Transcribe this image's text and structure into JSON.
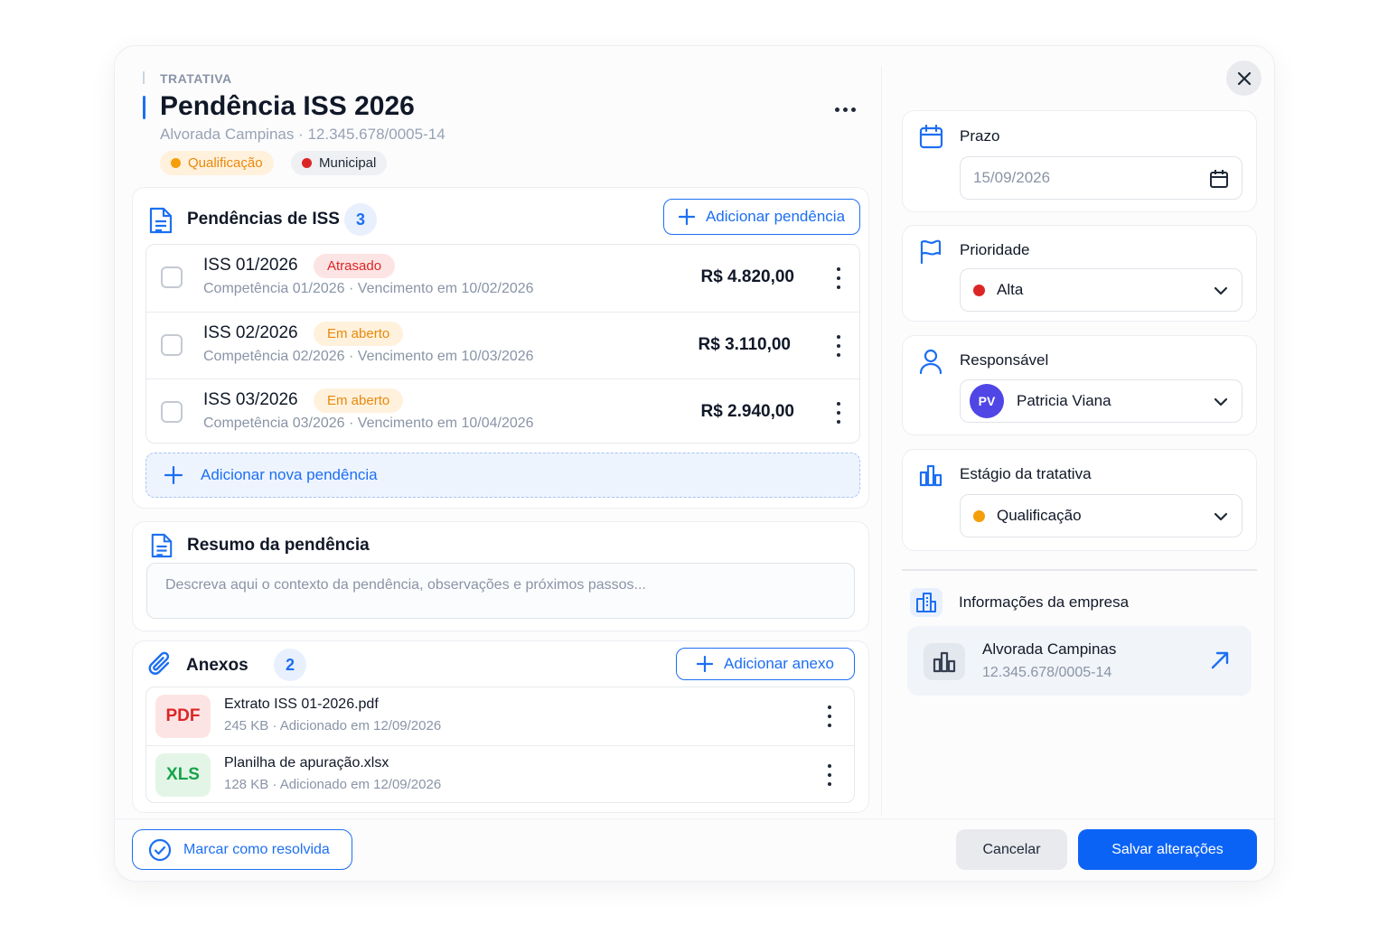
{
  "header": {
    "eyebrow": "TRATATIVA",
    "title": "Pendência ISS 2026",
    "subtitle": "Alvorada Campinas · 12.345.678/0005-14",
    "tags": [
      {
        "label": "Qualificação",
        "color": "#f59e0b"
      },
      {
        "label": "Municipal",
        "color": "#dc2626"
      }
    ]
  },
  "pendencias": {
    "title": "Pendências de ISS",
    "count": "3",
    "add_button": "Adicionar pendência",
    "items": [
      {
        "title": "ISS 01/2026",
        "status": "Atrasado",
        "meta": "Competência 01/2026 · Vencimento em 10/02/2026",
        "value": "R$ 4.820,00"
      },
      {
        "title": "ISS 02/2026",
        "status": "Em aberto",
        "meta": "Competência 02/2026 · Vencimento em 10/03/2026",
        "value": "R$ 3.110,00"
      },
      {
        "title": "ISS 03/2026",
        "status": "Em aberto",
        "meta": "Competência 03/2026 · Vencimento em 10/04/2026",
        "value": "R$ 2.940,00"
      }
    ],
    "add_new": "Adicionar nova pendência"
  },
  "resumo": {
    "title": "Resumo da pendência",
    "placeholder": "Descreva aqui o contexto da pendência, observações e próximos passos..."
  },
  "anexos": {
    "title": "Anexos",
    "count": "2",
    "add_button": "Adicionar anexo",
    "files": [
      {
        "type": "PDF",
        "name": "Extrato ISS 01-2026.pdf",
        "meta": "245 KB · Adicionado em 12/09/2026"
      },
      {
        "type": "XLS",
        "name": "Planilha de apuração.xlsx",
        "meta": "128 KB · Adicionado em 12/09/2026"
      }
    ]
  },
  "sidebar": {
    "prazo": {
      "label": "Prazo",
      "value": "15/09/2026"
    },
    "prioridade": {
      "label": "Prioridade",
      "value": "Alta",
      "color": "#dc2626"
    },
    "responsavel": {
      "label": "Responsável",
      "initials": "PV",
      "value": "Patricia Viana"
    },
    "estagio": {
      "label": "Estágio da tratativa",
      "value": "Qualificação",
      "color": "#f59e0b"
    },
    "empresa": {
      "label": "Informações da empresa",
      "name": "Alvorada Campinas",
      "cnpj": "12.345.678/0005-14"
    }
  },
  "footer": {
    "resolve": "Marcar como resolvida",
    "cancel": "Cancelar",
    "save": "Salvar alterações"
  },
  "colors": {
    "accent": "#1d6ff2",
    "primary_button": "#0b63f6"
  }
}
